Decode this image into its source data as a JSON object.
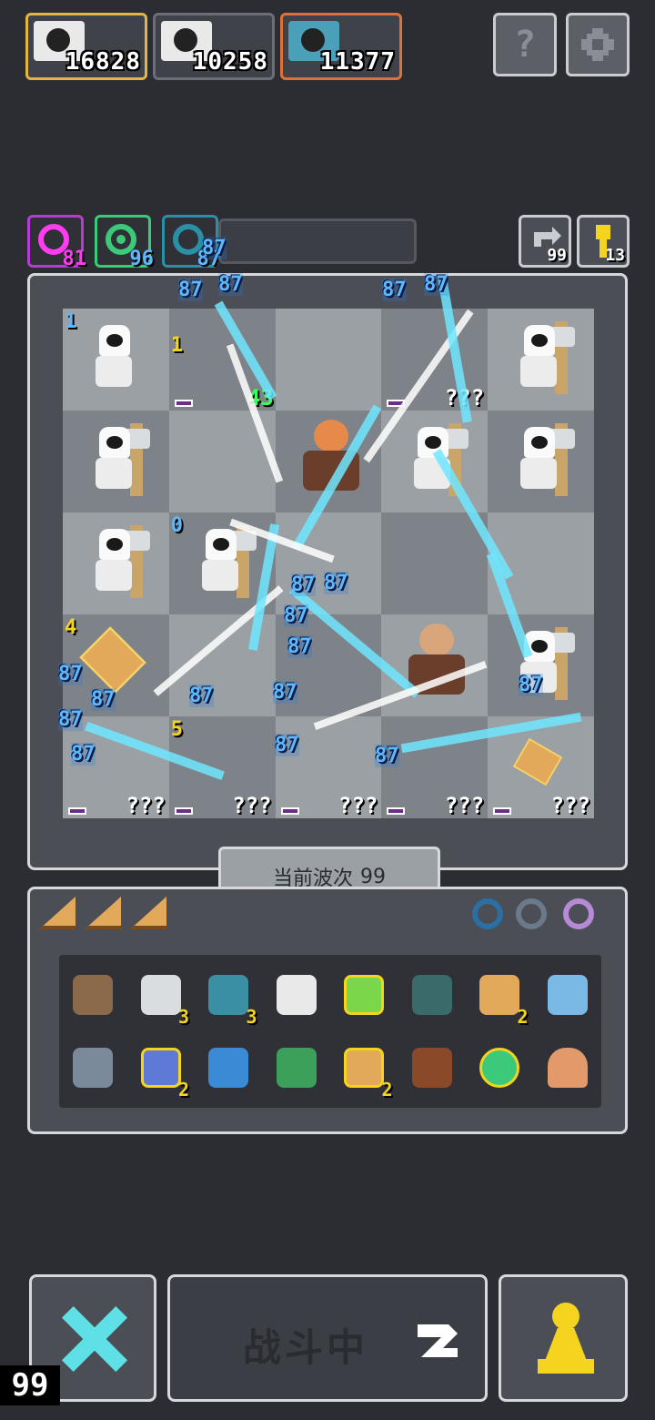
{
  "heroes": [
    {
      "score": "16828",
      "border_color": "#e3b640",
      "icon": "hero-portrait-icon"
    },
    {
      "score": "10258",
      "border_color": "#6b6e76",
      "icon": "hero-portrait-icon"
    },
    {
      "score": "11377",
      "border_color": "#e0703a",
      "icon": "boss-portrait-icon"
    }
  ],
  "top_buttons": {
    "help_symbol": "?",
    "settings_icon": "gear-icon"
  },
  "status": {
    "slots": [
      {
        "count": "81",
        "color": "#b63cd6",
        "count_color": "#ff3cf0"
      },
      {
        "count": "96",
        "color": "#3cc97a",
        "count_color": "#5eb8ff"
      },
      {
        "count": "87",
        "color": "#2b8fa5",
        "count_color": "#5eb8ff"
      }
    ],
    "refresh_count": "99",
    "key_count": "13"
  },
  "board": {
    "level_markers": [
      "1",
      "1",
      "0",
      "4",
      "5"
    ],
    "heal_text": "43",
    "unknown_label": "???",
    "damage_numbers": [
      "87",
      "87",
      "87",
      "87",
      "87",
      "87",
      "87",
      "87",
      "87",
      "87",
      "87",
      "87",
      "87",
      "87",
      "87",
      "87",
      "87",
      "87"
    ]
  },
  "wave": {
    "label": "当前波次",
    "number": "99"
  },
  "items": [
    {
      "icon": "hammer-icon",
      "count": "",
      "color": "#8a6a4a"
    },
    {
      "icon": "scroll-icon",
      "count": "3",
      "color": "#d9dde0"
    },
    {
      "icon": "heart-gem-icon",
      "count": "3",
      "color": "#3b8fa5"
    },
    {
      "icon": "feather-icon",
      "count": "",
      "color": "#e9e9e9"
    },
    {
      "icon": "potion-icon",
      "count": "",
      "color": "#7bd64a"
    },
    {
      "icon": "gauntlet-icon",
      "count": "",
      "color": "#3a6a6a"
    },
    {
      "icon": "trophy-icon",
      "count": "2",
      "color": "#e3a95a"
    },
    {
      "icon": "molecule-icon",
      "count": "",
      "color": "#7ab8e6"
    },
    {
      "icon": "ore-icon",
      "count": "",
      "color": "#7a8a9a"
    },
    {
      "icon": "magnet-icon",
      "count": "2",
      "color": "#5e7ad6"
    },
    {
      "icon": "ticket-icon",
      "count": "",
      "color": "#3a8ad6"
    },
    {
      "icon": "bin-icon",
      "count": "",
      "color": "#3ca05a"
    },
    {
      "icon": "map-icon",
      "count": "2",
      "color": "#e3a95a"
    },
    {
      "icon": "chest-icon",
      "count": "",
      "color": "#8a4a2a"
    },
    {
      "icon": "orb-icon",
      "count": "",
      "color": "#3cc97a"
    },
    {
      "icon": "bullet-icon",
      "count": "",
      "color": "#e39a6a"
    }
  ],
  "bottom": {
    "battle_label": "战斗中",
    "fps": "99"
  }
}
